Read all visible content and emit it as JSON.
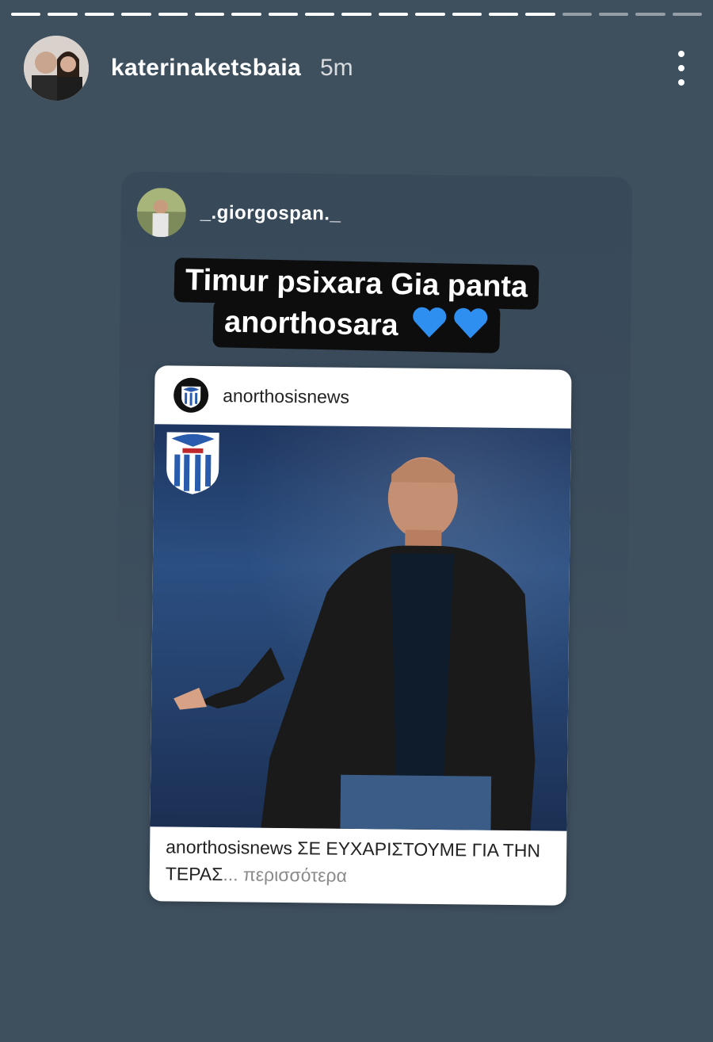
{
  "story": {
    "progress_total": 19,
    "progress_done": 15,
    "username": "katerinaketsbaia",
    "time": "5m"
  },
  "shared": {
    "username": "_.giorgospan._",
    "caption_line1": "Timur psixara Gia panta",
    "caption_line2": "anorthosara",
    "heart_color": "#2f8ff0"
  },
  "post": {
    "account": "anorthosisnews",
    "caption_user": "anorthosisnews",
    "caption_text": "ΣΕ ΕΥΧΑΡΙΣΤΟΥΜΕ ΓΙΑ ΤΗΝ ΤΕΡΑΣ",
    "more": "... περισσότερα"
  },
  "icons": [
    "more-vertical-icon",
    "blue-heart-icon",
    "anorthosis-crest-icon"
  ]
}
